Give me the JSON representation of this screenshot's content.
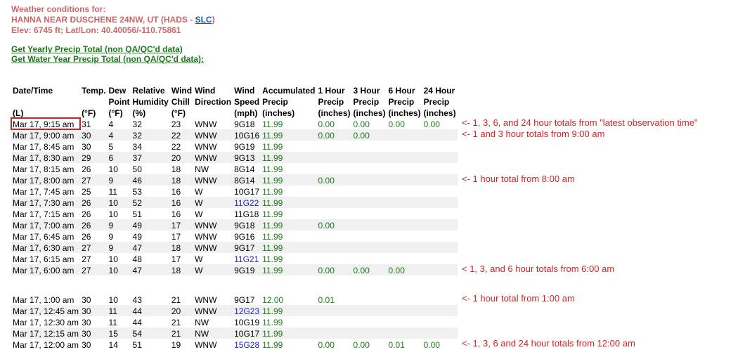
{
  "header": {
    "line1": "Weather conditions for:",
    "line2_prefix": "HANNA NEAR DUSCHENE 24NW, UT (HADS - ",
    "line2_link": "SLC",
    "line2_suffix": ")",
    "line3": "Elev: 6745 ft; Lat/Lon: 40.40056/-110.75861"
  },
  "links": {
    "yearly": "Get Yearly Precip Total (non QA/QC'd data)",
    "water_year": "Get Water Year Precip Total (non QA/QC'd data):"
  },
  "columns": [
    {
      "top": [
        "Date/Time",
        "",
        ""
      ],
      "unit": "(L)"
    },
    {
      "top": [
        "Temp.",
        "",
        ""
      ],
      "unit": "(°F)"
    },
    {
      "top": [
        "Dew",
        "Point",
        ""
      ],
      "unit": "(°F)"
    },
    {
      "top": [
        "Relative",
        "Humidity",
        ""
      ],
      "unit": "(%)"
    },
    {
      "top": [
        "Wind",
        "Chill",
        ""
      ],
      "unit": "(°F)"
    },
    {
      "top": [
        "Wind",
        "Direction",
        ""
      ],
      "unit": ""
    },
    {
      "top": [
        "Wind",
        "Speed",
        ""
      ],
      "unit": "(mph)"
    },
    {
      "top": [
        "Accumulated",
        "Precip",
        ""
      ],
      "unit": "(inches)"
    },
    {
      "top": [
        "1 Hour",
        "Precip",
        ""
      ],
      "unit": "(inches)"
    },
    {
      "top": [
        "3 Hour",
        "Precip",
        ""
      ],
      "unit": "(inches)"
    },
    {
      "top": [
        "6 Hour",
        "Precip",
        ""
      ],
      "unit": "(inches)"
    },
    {
      "top": [
        "24 Hour",
        "Precip",
        ""
      ],
      "unit": "(inches)"
    }
  ],
  "rows": [
    {
      "dt": "Mar 17, 9:15 am",
      "t": "31",
      "dp": "4",
      "rh": "32",
      "wc": "23",
      "wd": "WNW",
      "ws": "9",
      "wg": "18",
      "acc": "11.99",
      "p1": "0.00",
      "p3": "0.00",
      "p6": "0.00",
      "p24": "0.00",
      "highlight": true
    },
    {
      "dt": "Mar 17, 9:00 am",
      "t": "30",
      "dp": "4",
      "rh": "32",
      "wc": "22",
      "wd": "WNW",
      "ws": "10",
      "wg": "16",
      "acc": "11.99",
      "p1": "0.00",
      "p3": "0.00",
      "p6": "",
      "p24": ""
    },
    {
      "dt": "Mar 17, 8:45 am",
      "t": "30",
      "dp": "5",
      "rh": "34",
      "wc": "22",
      "wd": "WNW",
      "ws": "9",
      "wg": "19",
      "acc": "11.99",
      "p1": "",
      "p3": "",
      "p6": "",
      "p24": ""
    },
    {
      "dt": "Mar 17, 8:30 am",
      "t": "29",
      "dp": "6",
      "rh": "37",
      "wc": "20",
      "wd": "WNW",
      "ws": "9",
      "wg": "13",
      "acc": "11.99",
      "p1": "",
      "p3": "",
      "p6": "",
      "p24": ""
    },
    {
      "dt": "Mar 17, 8:15 am",
      "t": "26",
      "dp": "10",
      "rh": "50",
      "wc": "18",
      "wd": "NW",
      "ws": "8",
      "wg": "14",
      "acc": "11.99",
      "p1": "",
      "p3": "",
      "p6": "",
      "p24": ""
    },
    {
      "dt": "Mar 17, 8:00 am",
      "t": "27",
      "dp": "9",
      "rh": "46",
      "wc": "18",
      "wd": "WNW",
      "ws": "8",
      "wg": "14",
      "acc": "11.99",
      "p1": "0.00",
      "p3": "",
      "p6": "",
      "p24": ""
    },
    {
      "dt": "Mar 17, 7:45 am",
      "t": "25",
      "dp": "11",
      "rh": "53",
      "wc": "16",
      "wd": "W",
      "ws": "10",
      "wg": "17",
      "acc": "11.99",
      "p1": "",
      "p3": "",
      "p6": "",
      "p24": ""
    },
    {
      "dt": "Mar 17, 7:30 am",
      "t": "26",
      "dp": "10",
      "rh": "52",
      "wc": "16",
      "wd": "W",
      "ws": "11",
      "wg": "22",
      "acc": "11.99",
      "p1": "",
      "p3": "",
      "p6": "",
      "p24": "",
      "blue": true
    },
    {
      "dt": "Mar 17, 7:15 am",
      "t": "26",
      "dp": "10",
      "rh": "51",
      "wc": "16",
      "wd": "W",
      "ws": "11",
      "wg": "18",
      "acc": "11.99",
      "p1": "",
      "p3": "",
      "p6": "",
      "p24": ""
    },
    {
      "dt": "Mar 17, 7:00 am",
      "t": "26",
      "dp": "9",
      "rh": "49",
      "wc": "17",
      "wd": "WNW",
      "ws": "9",
      "wg": "18",
      "acc": "11.99",
      "p1": "0.00",
      "p3": "",
      "p6": "",
      "p24": ""
    },
    {
      "dt": "Mar 17, 6:45 am",
      "t": "26",
      "dp": "9",
      "rh": "49",
      "wc": "17",
      "wd": "WNW",
      "ws": "9",
      "wg": "16",
      "acc": "11.99",
      "p1": "",
      "p3": "",
      "p6": "",
      "p24": ""
    },
    {
      "dt": "Mar 17, 6:30 am",
      "t": "27",
      "dp": "9",
      "rh": "47",
      "wc": "18",
      "wd": "WNW",
      "ws": "9",
      "wg": "17",
      "acc": "11.99",
      "p1": "",
      "p3": "",
      "p6": "",
      "p24": ""
    },
    {
      "dt": "Mar 17, 6:15 am",
      "t": "27",
      "dp": "10",
      "rh": "48",
      "wc": "17",
      "wd": "W",
      "ws": "11",
      "wg": "21",
      "acc": "11.99",
      "p1": "",
      "p3": "",
      "p6": "",
      "p24": "",
      "blue": true
    },
    {
      "dt": "Mar 17, 6:00 am",
      "t": "27",
      "dp": "10",
      "rh": "47",
      "wc": "18",
      "wd": "W",
      "ws": "9",
      "wg": "19",
      "acc": "11.99",
      "p1": "0.00",
      "p3": "0.00",
      "p6": "0.00",
      "p24": ""
    },
    {
      "gap": true
    },
    {
      "dt": "Mar 17, 1:00 am",
      "t": "30",
      "dp": "10",
      "rh": "43",
      "wc": "21",
      "wd": "WNW",
      "ws": "9",
      "wg": "17",
      "acc": "12.00",
      "p1": "0.01",
      "p3": "",
      "p6": "",
      "p24": ""
    },
    {
      "dt": "Mar 17, 12:45 am",
      "t": "30",
      "dp": "11",
      "rh": "44",
      "wc": "20",
      "wd": "WNW",
      "ws": "12",
      "wg": "23",
      "acc": "11.99",
      "p1": "",
      "p3": "",
      "p6": "",
      "p24": "",
      "blue": true
    },
    {
      "dt": "Mar 17, 12:30 am",
      "t": "30",
      "dp": "11",
      "rh": "44",
      "wc": "21",
      "wd": "NW",
      "ws": "10",
      "wg": "19",
      "acc": "11.99",
      "p1": "",
      "p3": "",
      "p6": "",
      "p24": ""
    },
    {
      "dt": "Mar 17, 12:15 am",
      "t": "30",
      "dp": "15",
      "rh": "54",
      "wc": "21",
      "wd": "NW",
      "ws": "10",
      "wg": "17",
      "acc": "11.99",
      "p1": "",
      "p3": "",
      "p6": "",
      "p24": ""
    },
    {
      "dt": "Mar 17, 12:00 am",
      "t": "30",
      "dp": "14",
      "rh": "51",
      "wc": "19",
      "wd": "WNW",
      "ws": "15",
      "wg": "28",
      "acc": "11.99",
      "p1": "0.00",
      "p3": "0.00",
      "p6": "0.01",
      "p24": "0.00",
      "blue": true
    }
  ],
  "annotations": [
    {
      "text": "<- 1, 3, 6, and 24 hour totals from \"latest observation time\"",
      "row": 0
    },
    {
      "text": "<- 1 and 3 hour totals from 9:00 am",
      "row": 1
    },
    {
      "text": "<- 1 hour total from 8:00 am",
      "row": 5
    },
    {
      "text": "< 1, 3, and 6 hour totals from 6:00 am",
      "row": 13
    },
    {
      "text": "<- 1 hour total from 1:00 am",
      "row": 15
    },
    {
      "text": "<- 1, 3, 6 and 24 hour totals from 12:00 am",
      "row": 19
    }
  ],
  "colors": {
    "header_red": "#cc6666",
    "link_green": "#1a7a1a",
    "value_green": "#1a7a1a",
    "gust_blue": "#2222cc",
    "annotation_red": "#d62020",
    "highlight_box": "#d62020"
  }
}
